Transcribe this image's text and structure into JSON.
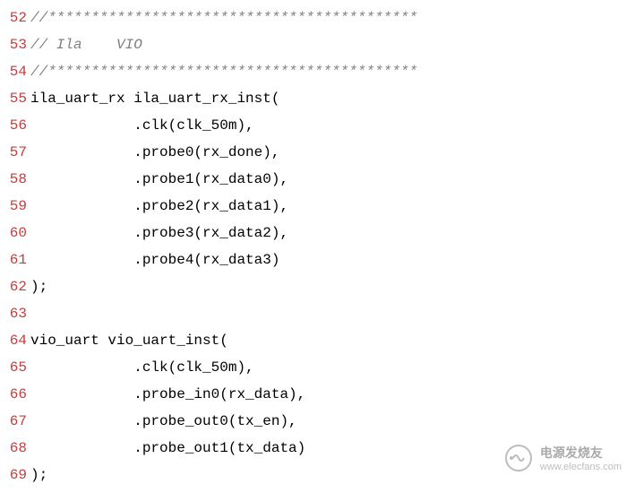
{
  "lines": [
    {
      "num": "52",
      "type": "comment",
      "text": "//*******************************************"
    },
    {
      "num": "53",
      "type": "comment",
      "text": "// Ila    VIO"
    },
    {
      "num": "54",
      "type": "comment",
      "text": "//*******************************************"
    },
    {
      "num": "55",
      "type": "code",
      "text": "ila_uart_rx ila_uart_rx_inst("
    },
    {
      "num": "56",
      "type": "code",
      "text": "            .clk(clk_50m),"
    },
    {
      "num": "57",
      "type": "code",
      "text": "            .probe0(rx_done),"
    },
    {
      "num": "58",
      "type": "code",
      "text": "            .probe1(rx_data0),"
    },
    {
      "num": "59",
      "type": "code",
      "text": "            .probe2(rx_data1),"
    },
    {
      "num": "60",
      "type": "code",
      "text": "            .probe3(rx_data2),"
    },
    {
      "num": "61",
      "type": "code",
      "text": "            .probe4(rx_data3)"
    },
    {
      "num": "62",
      "type": "code",
      "text": ");"
    },
    {
      "num": "63",
      "type": "code",
      "text": ""
    },
    {
      "num": "64",
      "type": "code",
      "text": "vio_uart vio_uart_inst("
    },
    {
      "num": "65",
      "type": "code",
      "text": "            .clk(clk_50m),"
    },
    {
      "num": "66",
      "type": "code",
      "text": "            .probe_in0(rx_data),"
    },
    {
      "num": "67",
      "type": "code",
      "text": "            .probe_out0(tx_en),"
    },
    {
      "num": "68",
      "type": "code",
      "text": "            .probe_out1(tx_data)"
    },
    {
      "num": "69",
      "type": "code",
      "text": ");"
    }
  ],
  "watermark": {
    "cn": "电源发烧友",
    "url": "www.elecfans.com"
  }
}
